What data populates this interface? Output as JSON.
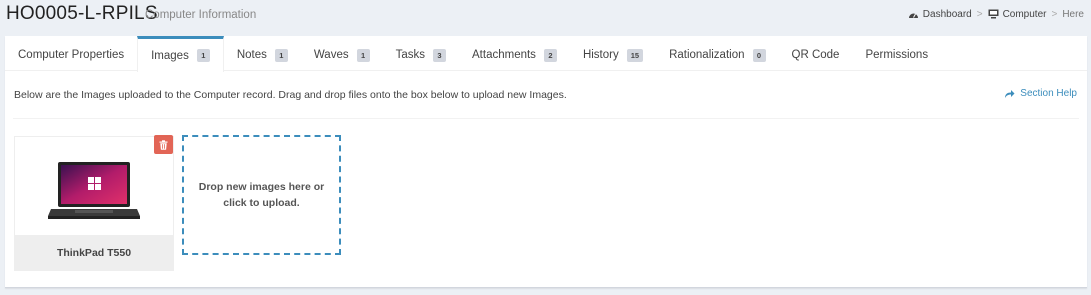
{
  "header": {
    "title": "HO0005-L-RPILS",
    "subtitle": "Computer Information"
  },
  "breadcrumb": {
    "items": [
      {
        "label": "Dashboard",
        "icon": "dashboard-icon"
      },
      {
        "label": "Computer",
        "icon": "monitor-icon"
      },
      {
        "label": "Here"
      }
    ],
    "separator": ">"
  },
  "tabs": [
    {
      "label": "Computer Properties"
    },
    {
      "label": "Images",
      "count": "1"
    },
    {
      "label": "Notes",
      "count": "1"
    },
    {
      "label": "Waves",
      "count": "1"
    },
    {
      "label": "Tasks",
      "count": "3"
    },
    {
      "label": "Attachments",
      "count": "2"
    },
    {
      "label": "History",
      "count": "15"
    },
    {
      "label": "Rationalization",
      "count": "0"
    },
    {
      "label": "QR Code"
    },
    {
      "label": "Permissions"
    }
  ],
  "active_tab": "Images",
  "content": {
    "intro": "Below are the Images uploaded to the Computer record. Drag and drop files onto the box below to upload new Images.",
    "section_help": "Section Help",
    "images": [
      {
        "caption": "ThinkPad T550",
        "icon": "laptop-image"
      }
    ],
    "dropzone_text": "Drop new images here or click to upload."
  },
  "colors": {
    "accent": "#3c8dbc",
    "delete": "#dd4b39",
    "background": "#ecf0f5"
  }
}
